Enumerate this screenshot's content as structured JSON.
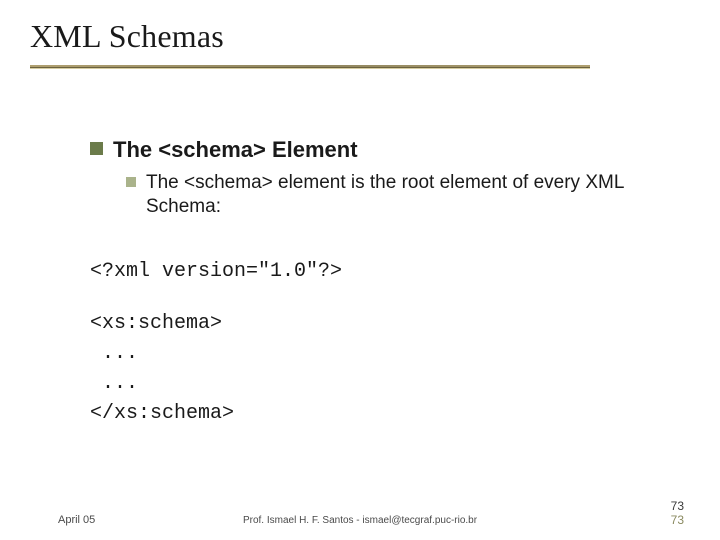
{
  "slide": {
    "title": "XML Schemas",
    "bullet_main": "The <schema> Element",
    "bullet_sub": "The <schema> element is the root element of every XML Schema:",
    "code": {
      "line1": "<?xml version=\"1.0\"?>",
      "line2": "<xs:schema>",
      "line3": " ...",
      "line4": " ...",
      "line5": "</xs:schema>"
    }
  },
  "footer": {
    "date": "April 05",
    "center": "Prof. Ismael H. F. Santos - ismael@tecgraf.puc-rio.br",
    "page_top": "73",
    "page_bottom": "73"
  }
}
